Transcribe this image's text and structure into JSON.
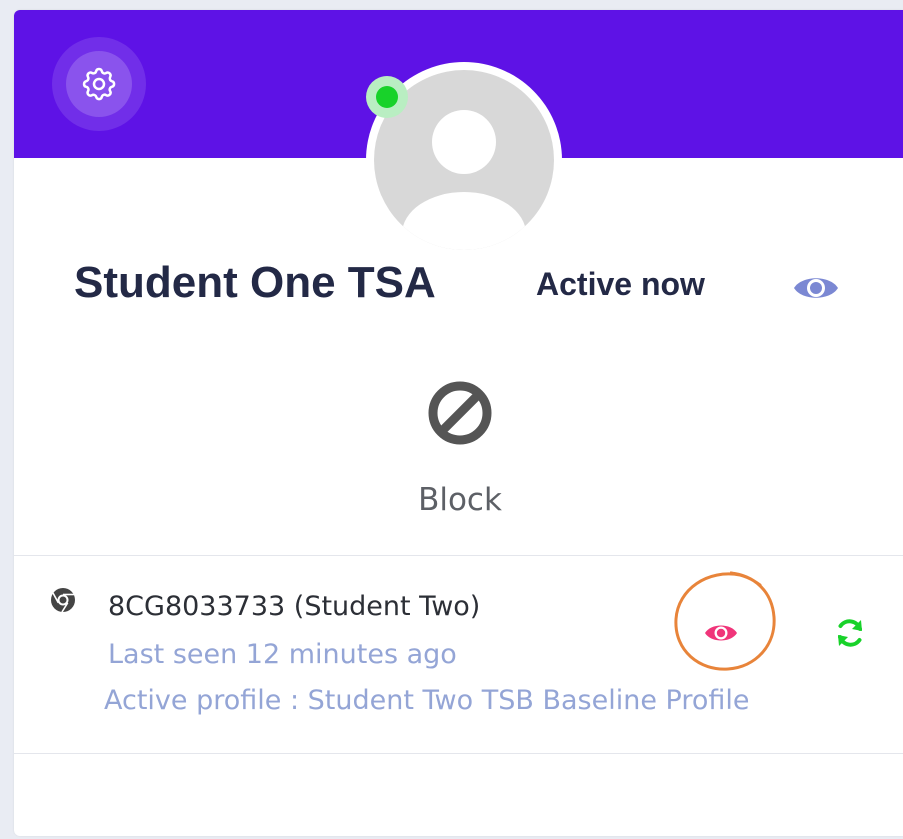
{
  "header": {
    "banner_color": "#5e12e6",
    "settings_icon": "gear-icon"
  },
  "profile": {
    "name": "Student One TSA",
    "status": "Active now",
    "online_color": "#18d22a",
    "view_icon": "eye-icon"
  },
  "actions": {
    "block_label": "Block",
    "block_icon": "block-icon"
  },
  "devices": [
    {
      "browser_icon": "chrome-icon",
      "name": "8CG8033733 (Student Two)",
      "last_seen": "Last seen 12 minutes ago",
      "active_profile": "Active profile : Student Two TSB Baseline Profile",
      "view_icon": "eye-icon",
      "view_icon_color": "#f0357a",
      "refresh_icon": "refresh-icon",
      "refresh_icon_color": "#18d22a",
      "annotation_color": "#e8843a"
    }
  ]
}
